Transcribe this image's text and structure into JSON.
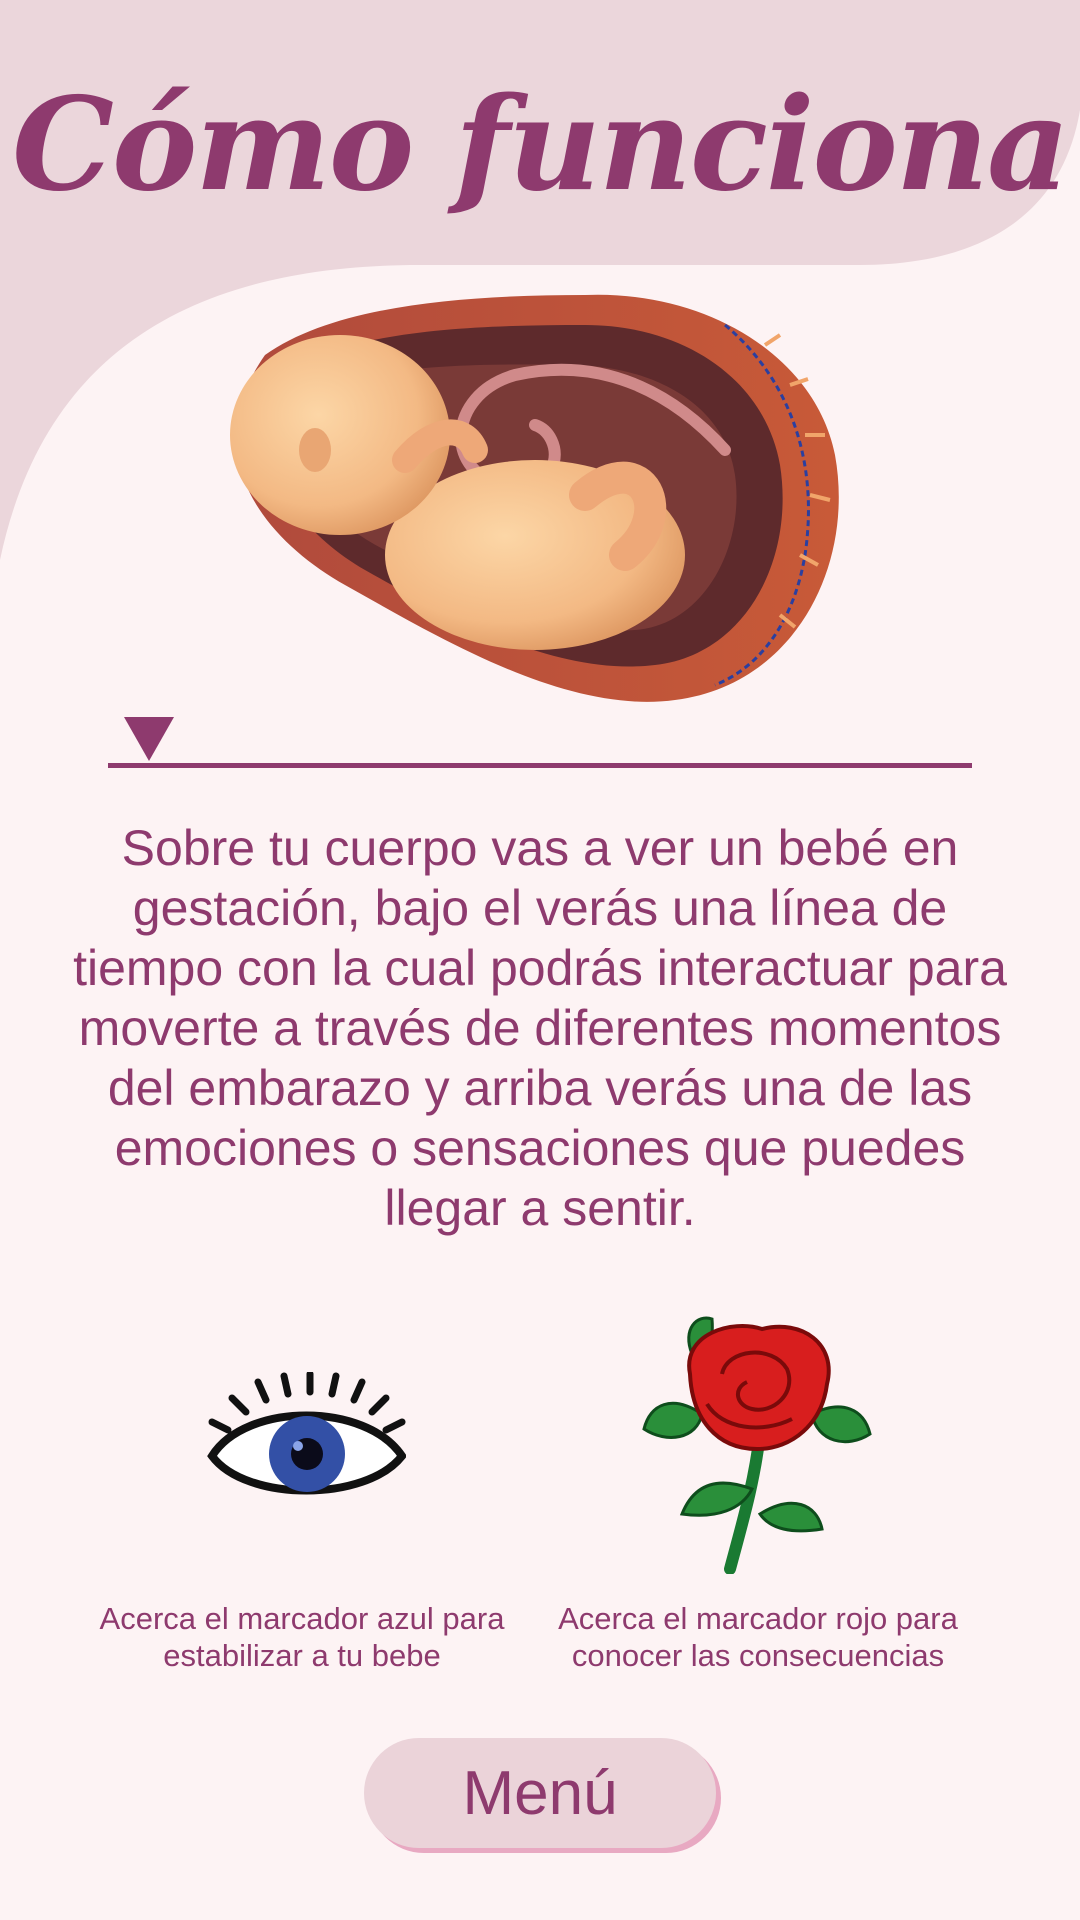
{
  "header": {
    "title": "Cómo funciona"
  },
  "description": "Sobre tu cuerpo vas a ver un bebé en gestación, bajo el verás una línea de tiempo con la cual podrás interactuar para moverte a través de diferentes momentos del embarazo y arriba verás una de las emociones o sensaciones que puedes llegar a sentir.",
  "markers": [
    {
      "icon": "eye-marker-icon",
      "caption": "Acerca el marcador azul para estabilizar a tu bebe"
    },
    {
      "icon": "rose-marker-icon",
      "caption": "Acerca el marcador rojo para conocer las consecuencias"
    }
  ],
  "menu": {
    "label": "Menú"
  },
  "colors": {
    "accent": "#8e3a6e",
    "header_bg": "#ebd6db",
    "page_bg": "#fdf3f4",
    "button_shadow": "#e8a9c2"
  }
}
